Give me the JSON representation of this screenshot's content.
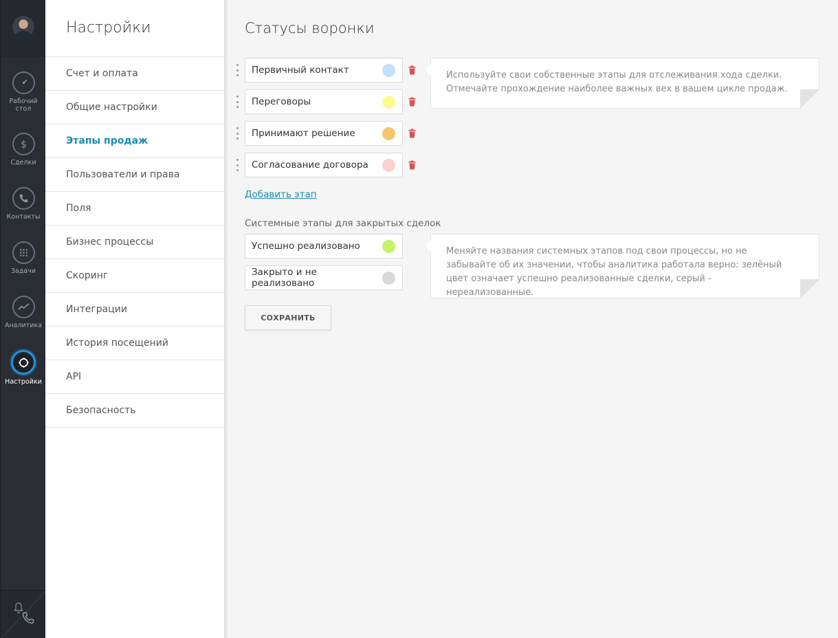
{
  "rail": {
    "items": [
      {
        "label": "Рабочий стол",
        "icon": "dashboard-gauge-icon"
      },
      {
        "label": "Сделки",
        "icon": "dollar-icon"
      },
      {
        "label": "Контакты",
        "icon": "phone-icon"
      },
      {
        "label": "Задачи",
        "icon": "calendar-icon"
      },
      {
        "label": "Аналитика",
        "icon": "chart-line-icon"
      },
      {
        "label": "Настройки",
        "icon": "gear-icon"
      }
    ],
    "bottom_icons": [
      "bell-icon",
      "phone-icon"
    ]
  },
  "settings": {
    "title": "Настройки",
    "menu": [
      "Счет и оплата",
      "Общие настройки",
      "Этапы продаж",
      "Пользователи и права",
      "Поля",
      "Бизнес процессы",
      "Скоринг",
      "Интеграции",
      "История посещений",
      "API",
      "Безопасность"
    ],
    "active": "Этапы продаж"
  },
  "main": {
    "title": "Статусы воронки",
    "stages": [
      {
        "name": "Первичный контакт",
        "color": "#c4e0fb"
      },
      {
        "name": "Переговоры",
        "color": "#fbfb90"
      },
      {
        "name": "Принимают решение",
        "color": "#f6c66b"
      },
      {
        "name": "Согласование договора",
        "color": "#fbd0d0"
      }
    ],
    "add_stage_label": "Добавить этап",
    "system_heading": "Системные этапы для закрытых сделок",
    "system_stages": [
      {
        "name": "Успешно реализовано",
        "color": "#c8f26a"
      },
      {
        "name": "Закрыто и не реализовано",
        "color": "#d9d9d9"
      }
    ],
    "save_label": "СОХРАНИТЬ",
    "hint_stages": "Используйте свои собственные этапы для отслеживания хода сделки. Отмечайте прохождение наиболее важных вех в вашем цикле продаж.",
    "hint_system": "Меняйте названия системных этапов под свои процессы, но не забывайте об их значении, чтобы аналитика работала верно: зелёный цвет означает успешно реализованные сделки, серый - нереализованные."
  },
  "colors": {
    "accent": "#1a8cb3",
    "rail_bg": "#2a2d33",
    "active_ring": "#2b8fcf",
    "trash": "#d9534f"
  }
}
